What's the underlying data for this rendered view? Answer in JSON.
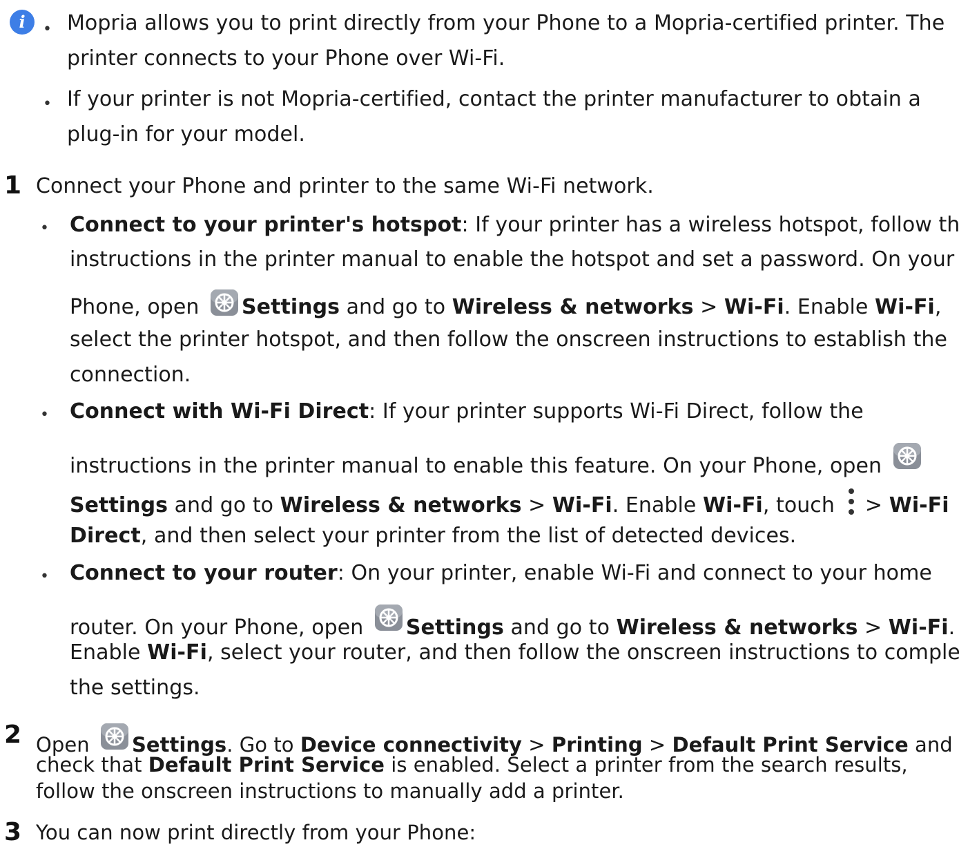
{
  "note": {
    "icon": "info-icon",
    "bullets": [
      {
        "lines": [
          "Mopria allows you to print directly from your Phone to a Mopria-certified printer. The",
          "printer connects to your Phone over Wi-Fi."
        ]
      },
      {
        "lines": [
          "If your printer is not Mopria-certified, contact the printer manufacturer to obtain a",
          "plug-in for your model."
        ]
      }
    ]
  },
  "steps": {
    "s1": {
      "num": "1",
      "text": "Connect your Phone and printer to the same Wi-Fi network.",
      "opt_a": {
        "title": "Connect to your printer's hotspot",
        "l1": ": If your printer has a wireless hotspot, follow the",
        "l2": "instructions in the printer manual to enable the hotspot and set a password. On your",
        "l3_pre": "Phone, open ",
        "settings": "Settings",
        "and_go_to": " and go to ",
        "wireless": "Wireless & networks",
        "gt": " > ",
        "wifi": "Wi-Fi",
        "enable": ". Enable ",
        "comma": ",",
        "l4": "select the printer hotspot, and then follow the onscreen instructions to establish the",
        "l5": "connection."
      },
      "opt_b": {
        "title": "Connect with Wi-Fi Direct",
        "l1": ": If your printer supports Wi-Fi Direct, follow the",
        "l2": "instructions in the printer manual to enable this feature. On your Phone, open",
        "settings": "Settings",
        "and_go_to": " and go to ",
        "wireless": "Wireless & networks",
        "gt": " > ",
        "wifi": "Wi-Fi",
        "enable": ". Enable ",
        "touch": ", touch",
        "gt2": "> ",
        "wifi_direct_1": "Wi-Fi",
        "wifi_direct_2": "Direct",
        "l4_rest": ", and then select your printer from the list of detected devices."
      },
      "opt_c": {
        "title": "Connect to your router",
        "l1": ": On your printer, enable Wi-Fi and connect to your home",
        "l2_pre": "router. On your Phone, open ",
        "settings": "Settings",
        "and_go_to": " and go to ",
        "wireless": "Wireless & networks",
        "gt": " > ",
        "wifi": "Wi-Fi",
        "period": ".",
        "l3_pre": "Enable ",
        "l3_rest": ", select your router, and then follow the onscreen instructions to complete",
        "l4": "the settings."
      }
    },
    "s2": {
      "num": "2",
      "open": "Open ",
      "settings": "Settings",
      "goto": ". Go to ",
      "device_conn": "Device connectivity",
      "gt": " > ",
      "printing": "Printing",
      "default_ps": "Default Print Service",
      "and": " and",
      "l2_pre": "check that ",
      "l2_rest": " is enabled. Select a printer from the search results,",
      "l3": "follow the onscreen instructions to manually add a printer."
    },
    "s3": {
      "num": "3",
      "text": "You can now print directly from your Phone:"
    }
  }
}
